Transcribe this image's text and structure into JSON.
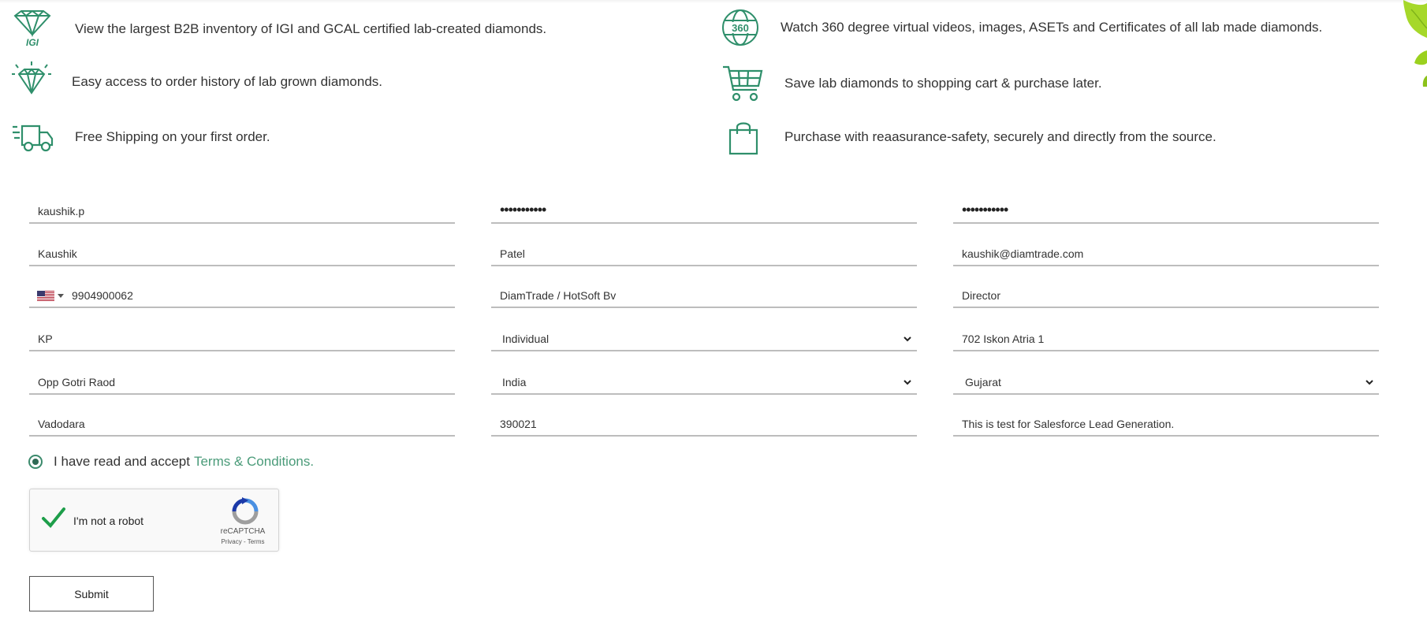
{
  "features": [
    {
      "text": "View the largest B2B inventory of IGI and GCAL certified lab-created diamonds.",
      "icon": "igi-diamond-icon"
    },
    {
      "text": "Watch 360 degree virtual videos, images, ASETs and Certificates of all lab made diamonds.",
      "icon": "globe-360-icon"
    },
    {
      "text": "Easy access to order history of lab grown diamonds.",
      "icon": "diamond-icon"
    },
    {
      "text": "Save lab diamonds to shopping cart & purchase later.",
      "icon": "shopping-cart-icon"
    },
    {
      "text": "Free Shipping on your first order.",
      "icon": "delivery-truck-icon"
    },
    {
      "text": "Purchase with reaasurance-safety, securely and directly from the source.",
      "icon": "shopping-bag-icon"
    }
  ],
  "icon_color": "#2f8f6b",
  "accent_color": "#4a9b79",
  "form": {
    "username": "kaushik.p",
    "password": "•••••••••••",
    "confirm_password": "•••••••••••",
    "first_name": "Kaushik",
    "last_name": "Patel",
    "email": "kaushik@diamtrade.com",
    "phone_country": "us-flag-icon",
    "phone": "9904900062",
    "company": "DiamTrade / HotSoft Bv",
    "designation": "Director",
    "short_name": "KP",
    "business_type": "Individual",
    "address_line1": "702 Iskon Atria 1",
    "address_line2": "Opp Gotri Raod",
    "country": "India",
    "state": "Gujarat",
    "city": "Vadodara",
    "zip": "390021",
    "comments": "This is test for Salesforce Lead Generation."
  },
  "terms": {
    "text": "I have read and accept",
    "link": "Terms & Conditions."
  },
  "recaptcha": {
    "label": "I'm not a robot",
    "brand": "reCAPTCHA",
    "links": "Privacy - Terms"
  },
  "submit_label": "Submit"
}
